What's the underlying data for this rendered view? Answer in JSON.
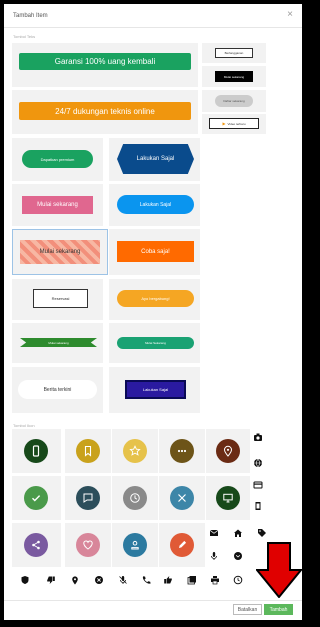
{
  "dialog": {
    "title": "Tambah Item",
    "close_glyph": "×",
    "section_buttons": "Tombol Teks",
    "section_icons": "Tombol Ikon"
  },
  "buttons": {
    "guarantee": "Garansi 100% uang kembali",
    "support": "24/7 dukungan teknis online",
    "subscribe_small": "Berlangganan",
    "subscribe_black": "Mulai sekarang",
    "subscribe_grey": "Daftar sekarang",
    "video": "Video terbaru",
    "premium": "Dapatkan premium",
    "do_now": "Lakukan Sajal",
    "start_now_pink": "Mulai sekarang",
    "do_now_pill": "Lakukan Sajal",
    "start_now_image": "Mulai sekarang",
    "try_now": "Coba saja!",
    "reservation": "Reservasi",
    "come_join": "Ayo bergabung!",
    "ribbon_start": "Mulai sekarang",
    "register_pill": "Mulai Sekarang",
    "latest_news": "Berita terkini",
    "do_now_blue": "Lakukan Sajal"
  },
  "footer": {
    "cancel": "Batalkan",
    "add": "Tambah"
  },
  "colors": {
    "green": "#1aa260",
    "orange": "#f0960e",
    "navy": "#0a4b8c",
    "blue": "#0a95ef",
    "pink": "#e0678f",
    "red_arrow": "#e00000",
    "footer_green": "#5cb85c"
  },
  "icons": {
    "big": [
      "phone-icon",
      "bookmark-icon",
      "star-icon",
      "more-dots-icon",
      "location-pin-icon",
      "check-icon",
      "chat-icon",
      "clock-icon",
      "restaurant-icon",
      "monitor-icon",
      "share-icon",
      "heart-icon",
      "user-icon",
      "edit-icon"
    ],
    "small": [
      "camera-icon",
      "globe-icon",
      "credit-card-icon",
      "film-icon",
      "mail-icon",
      "home-icon",
      "tag-icon",
      "microphone-icon",
      "chevron-circle-icon",
      "shield-icon",
      "thumbs-down-icon",
      "pin-icon",
      "close-circle-icon",
      "mic-off-icon",
      "call-icon",
      "thumbs-up-icon",
      "gallery-icon",
      "print-icon",
      "time-icon"
    ]
  }
}
